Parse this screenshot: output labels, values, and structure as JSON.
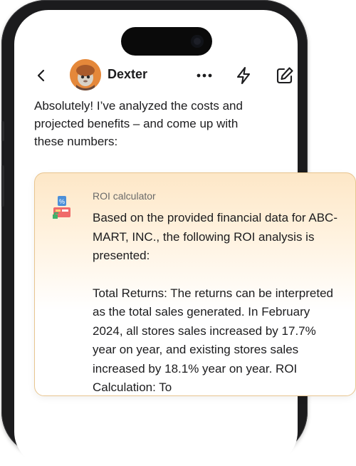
{
  "header": {
    "contact_name": "Dexter"
  },
  "message": {
    "text": "Absolutely! I’ve analyzed the costs and projected benefits – and come up with these numbers:"
  },
  "card": {
    "title": "ROI calculator",
    "paragraph1": "Based on the provided financial data for ABC-MART, INC., the following ROI analysis is presented:",
    "paragraph2": "Total Returns: The returns can be interpreted as the total sales generated. In February 2024, all stores sales increased by 17.7% year on year, and existing stores sales increased by 18.1% year on year.  ROI Calculation: To"
  },
  "icons": {
    "back": "chevron-left-icon",
    "more": "more-dots-icon",
    "bolt": "lightning-bolt-icon",
    "edit": "edit-pencil-icon",
    "calculator": "roi-calculator-icon"
  },
  "colors": {
    "card_border": "#e8c58f",
    "card_top": "#fde7c7",
    "frame": "#1b1b1d",
    "text": "#1c1c1e"
  }
}
